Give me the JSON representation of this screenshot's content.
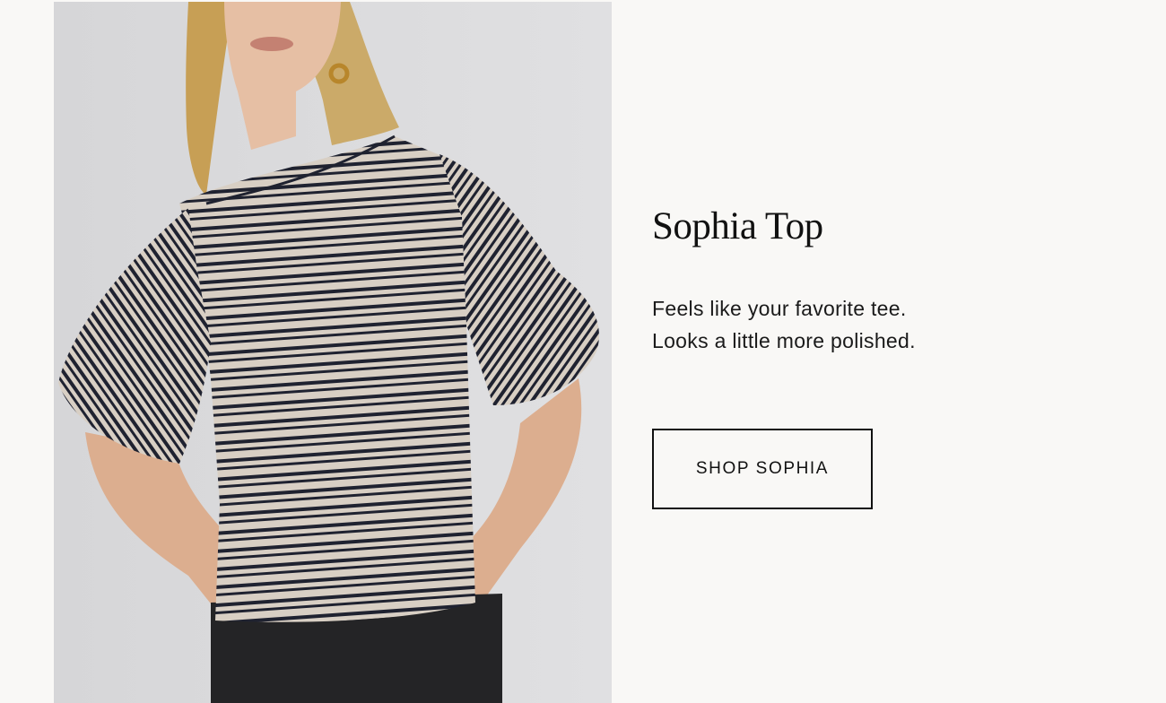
{
  "product": {
    "title": "Sophia Top",
    "description_lines": [
      "Feels like your favorite tee.",
      "Looks a little more polished."
    ],
    "cta_label": "SHOP SOPHIA"
  },
  "colors": {
    "page_background": "#f9f8f6",
    "text": "#111111",
    "stripe_dark": "#1f2230",
    "stripe_light": "#d8cfc4"
  }
}
